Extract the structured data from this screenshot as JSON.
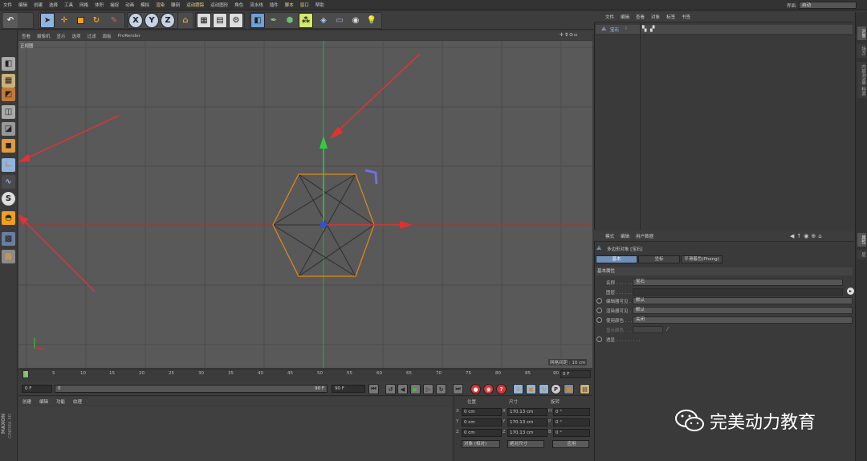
{
  "menubar": {
    "items": [
      "文件",
      "编辑",
      "创建",
      "选择",
      "工具",
      "网格",
      "体积",
      "捕捉",
      "动画",
      "模拟",
      "渲染",
      "雕刻",
      "运动跟踪",
      "运动图形",
      "角色",
      "流水线",
      "插件",
      "脚本",
      "窗口",
      "帮助"
    ],
    "layout_label": "界面:",
    "layout_value": "启动"
  },
  "toolbar": {
    "axis_x": "X",
    "axis_y": "Y",
    "axis_z": "Z"
  },
  "viewport": {
    "menu": [
      "查看",
      "摄像机",
      "显示",
      "选项",
      "过滤",
      "面板",
      "ProRender"
    ],
    "label": "正视图",
    "grid_spacing": "网格间距 : 10 cm"
  },
  "timeline": {
    "ticks": [
      "0",
      "5",
      "10",
      "15",
      "20",
      "25",
      "30",
      "35",
      "40",
      "45",
      "50",
      "55",
      "60",
      "65",
      "70",
      "75",
      "80",
      "85",
      "90"
    ],
    "current_frame": "0 F",
    "start_field": "0 F",
    "range_start": "0",
    "range_end": "90 F",
    "end_field": "90 F"
  },
  "material": {
    "menu": [
      "创建",
      "编辑",
      "功能",
      "纹理"
    ]
  },
  "coordinates": {
    "headers": {
      "position": "位置",
      "size": "尺寸",
      "rotation": "旋转"
    },
    "rows": [
      {
        "axis": "X",
        "pos": "0 cm",
        "size": "170.13 cm",
        "rot_label": "H",
        "rot": "0 °"
      },
      {
        "axis": "Y",
        "pos": "0 cm",
        "size": "170.13 cm",
        "rot_label": "P",
        "rot": "0 °"
      },
      {
        "axis": "Z",
        "pos": "0 cm",
        "size": "170.13 cm",
        "rot_label": "B",
        "rot": "0 °"
      }
    ],
    "mode": "对象 (相对)",
    "size_mode": "绝对尺寸",
    "apply": "应用"
  },
  "object_manager": {
    "menu": [
      "文件",
      "编辑",
      "查看",
      "对象",
      "标签",
      "书签"
    ],
    "object_name": "宝石"
  },
  "attributes": {
    "menu": [
      "模式",
      "编辑",
      "用户数据"
    ],
    "title": "多边形对象 [宝石]",
    "tabs": [
      "基本",
      "坐标",
      "平滑着色(Phong)"
    ],
    "section": "基本属性",
    "fields": [
      {
        "label": "名称 . . . . . . . . .",
        "value": "宝石"
      },
      {
        "label": "图层 . . . . . . . . .",
        "value": ""
      },
      {
        "label": "编辑器可见 . . .",
        "value": "默认"
      },
      {
        "label": "渲染器可见 . . .",
        "value": "默认"
      },
      {
        "label": "使用颜色 . . . . .",
        "value": "关闭"
      },
      {
        "label": "显示颜色 . . . .",
        "value": ""
      },
      {
        "label": "透显 . . . . . . . . .",
        "value": ""
      }
    ]
  },
  "right_tabs": [
    "对象",
    "场次",
    "内容浏览器",
    "构造",
    "属性",
    "层"
  ],
  "watermark": "完美动力教育",
  "brand": {
    "maxon": "MAXON",
    "c4d": "CINEMA 4D"
  }
}
